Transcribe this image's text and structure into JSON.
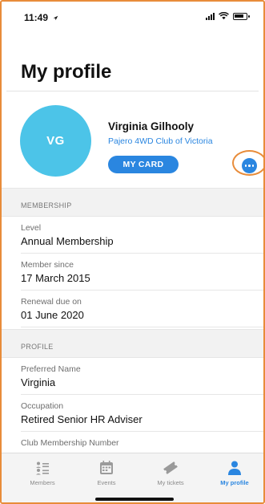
{
  "status_bar": {
    "time": "11:49"
  },
  "page": {
    "title": "My profile"
  },
  "profile": {
    "initials": "VG",
    "name": "Virginia Gilhooly",
    "club": "Pajero 4WD Club of Victoria",
    "my_card_label": "MY CARD",
    "avatar_color": "#4cc4e8",
    "accent_color": "#2a86e0",
    "highlight_color": "#e88c3a"
  },
  "membership": {
    "header": "MEMBERSHIP",
    "rows": [
      {
        "label": "Level",
        "value": "Annual Membership"
      },
      {
        "label": "Member since",
        "value": "17 March 2015"
      },
      {
        "label": "Renewal due on",
        "value": "01 June 2020"
      }
    ]
  },
  "profile_section": {
    "header": "PROFILE",
    "rows": [
      {
        "label": "Preferred Name",
        "value": "Virginia"
      },
      {
        "label": "Occupation",
        "value": "Retired Senior HR Adviser"
      },
      {
        "label": "Club Membership Number",
        "value": ""
      }
    ]
  },
  "tab_bar": {
    "tabs": [
      {
        "label": "Members",
        "icon": "members-icon",
        "active": false
      },
      {
        "label": "Events",
        "icon": "events-icon",
        "active": false
      },
      {
        "label": "My tickets",
        "icon": "ticket-icon",
        "active": false
      },
      {
        "label": "My profile",
        "icon": "person-icon",
        "active": true
      }
    ]
  }
}
